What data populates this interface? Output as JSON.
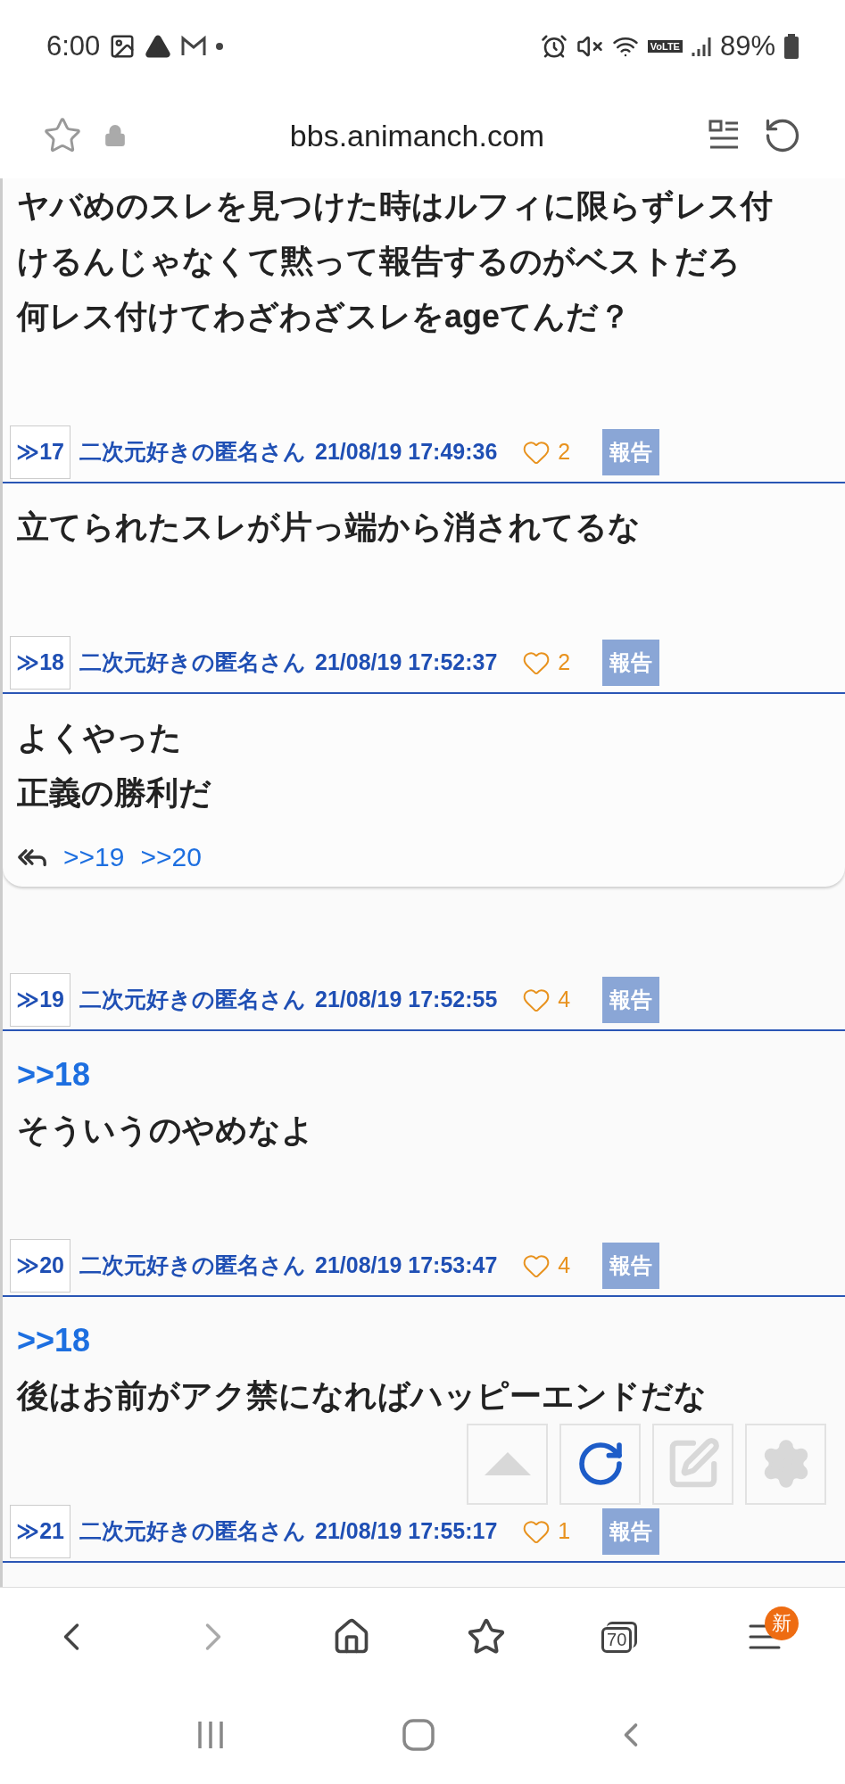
{
  "status_bar": {
    "time": "6:00",
    "network": "VoLTE",
    "battery": "89%"
  },
  "address_bar": {
    "url": "bbs.animanch.com"
  },
  "thread": {
    "posts": [
      {
        "body": [
          {
            "kind": "text",
            "text": "ヤバめのスレを見つけた時はルフィに限らずレス付"
          },
          {
            "kind": "text",
            "text": "けるんじゃなくて黙って報告するのがベストだろ"
          },
          {
            "kind": "text",
            "text": "何レス付けてわざわざスレをageてんだ？"
          }
        ]
      },
      {
        "number": "≫17",
        "author": "二次元好きの匿名さん",
        "datetime": "21/08/19 17:49:36",
        "likes": "2",
        "report": "報告",
        "body": [
          {
            "kind": "text",
            "text": "立てられたスレが片っ端から消されてるな"
          }
        ]
      },
      {
        "number": "≫18",
        "author": "二次元好きの匿名さん",
        "datetime": "21/08/19 17:52:37",
        "likes": "2",
        "report": "報告",
        "body": [
          {
            "kind": "text",
            "text": "よくやった"
          },
          {
            "kind": "text",
            "text": "正義の勝利だ"
          }
        ],
        "replies": [
          ">>19",
          ">>20"
        ]
      },
      {
        "number": "≫19",
        "author": "二次元好きの匿名さん",
        "datetime": "21/08/19 17:52:55",
        "likes": "4",
        "report": "報告",
        "body": [
          {
            "kind": "anchor",
            "text": ">>18"
          },
          {
            "kind": "text",
            "text": "そういうのやめなよ"
          }
        ]
      },
      {
        "number": "≫20",
        "author": "二次元好きの匿名さん",
        "datetime": "21/08/19 17:53:47",
        "likes": "4",
        "report": "報告",
        "body": [
          {
            "kind": "anchor",
            "text": ">>18"
          },
          {
            "kind": "text",
            "text": "後はお前がアク禁になればハッピーエンドだな"
          }
        ]
      },
      {
        "number": "≫21",
        "author": "二次元好きの匿名さん",
        "datetime": "21/08/19 17:55:17",
        "likes": "1",
        "report": "報告"
      }
    ]
  },
  "floating_buttons": [
    {
      "kind": "top"
    },
    {
      "kind": "reload"
    },
    {
      "kind": "write"
    },
    {
      "kind": "settings"
    }
  ],
  "bottom_nav": [
    {
      "kind": "back",
      "disabled": false
    },
    {
      "kind": "forward",
      "disabled": true
    },
    {
      "kind": "home",
      "disabled": false
    },
    {
      "kind": "bookmarks",
      "disabled": false
    },
    {
      "kind": "tabs",
      "count": "70",
      "disabled": false
    },
    {
      "kind": "menu",
      "badge": "新",
      "disabled": false
    }
  ]
}
